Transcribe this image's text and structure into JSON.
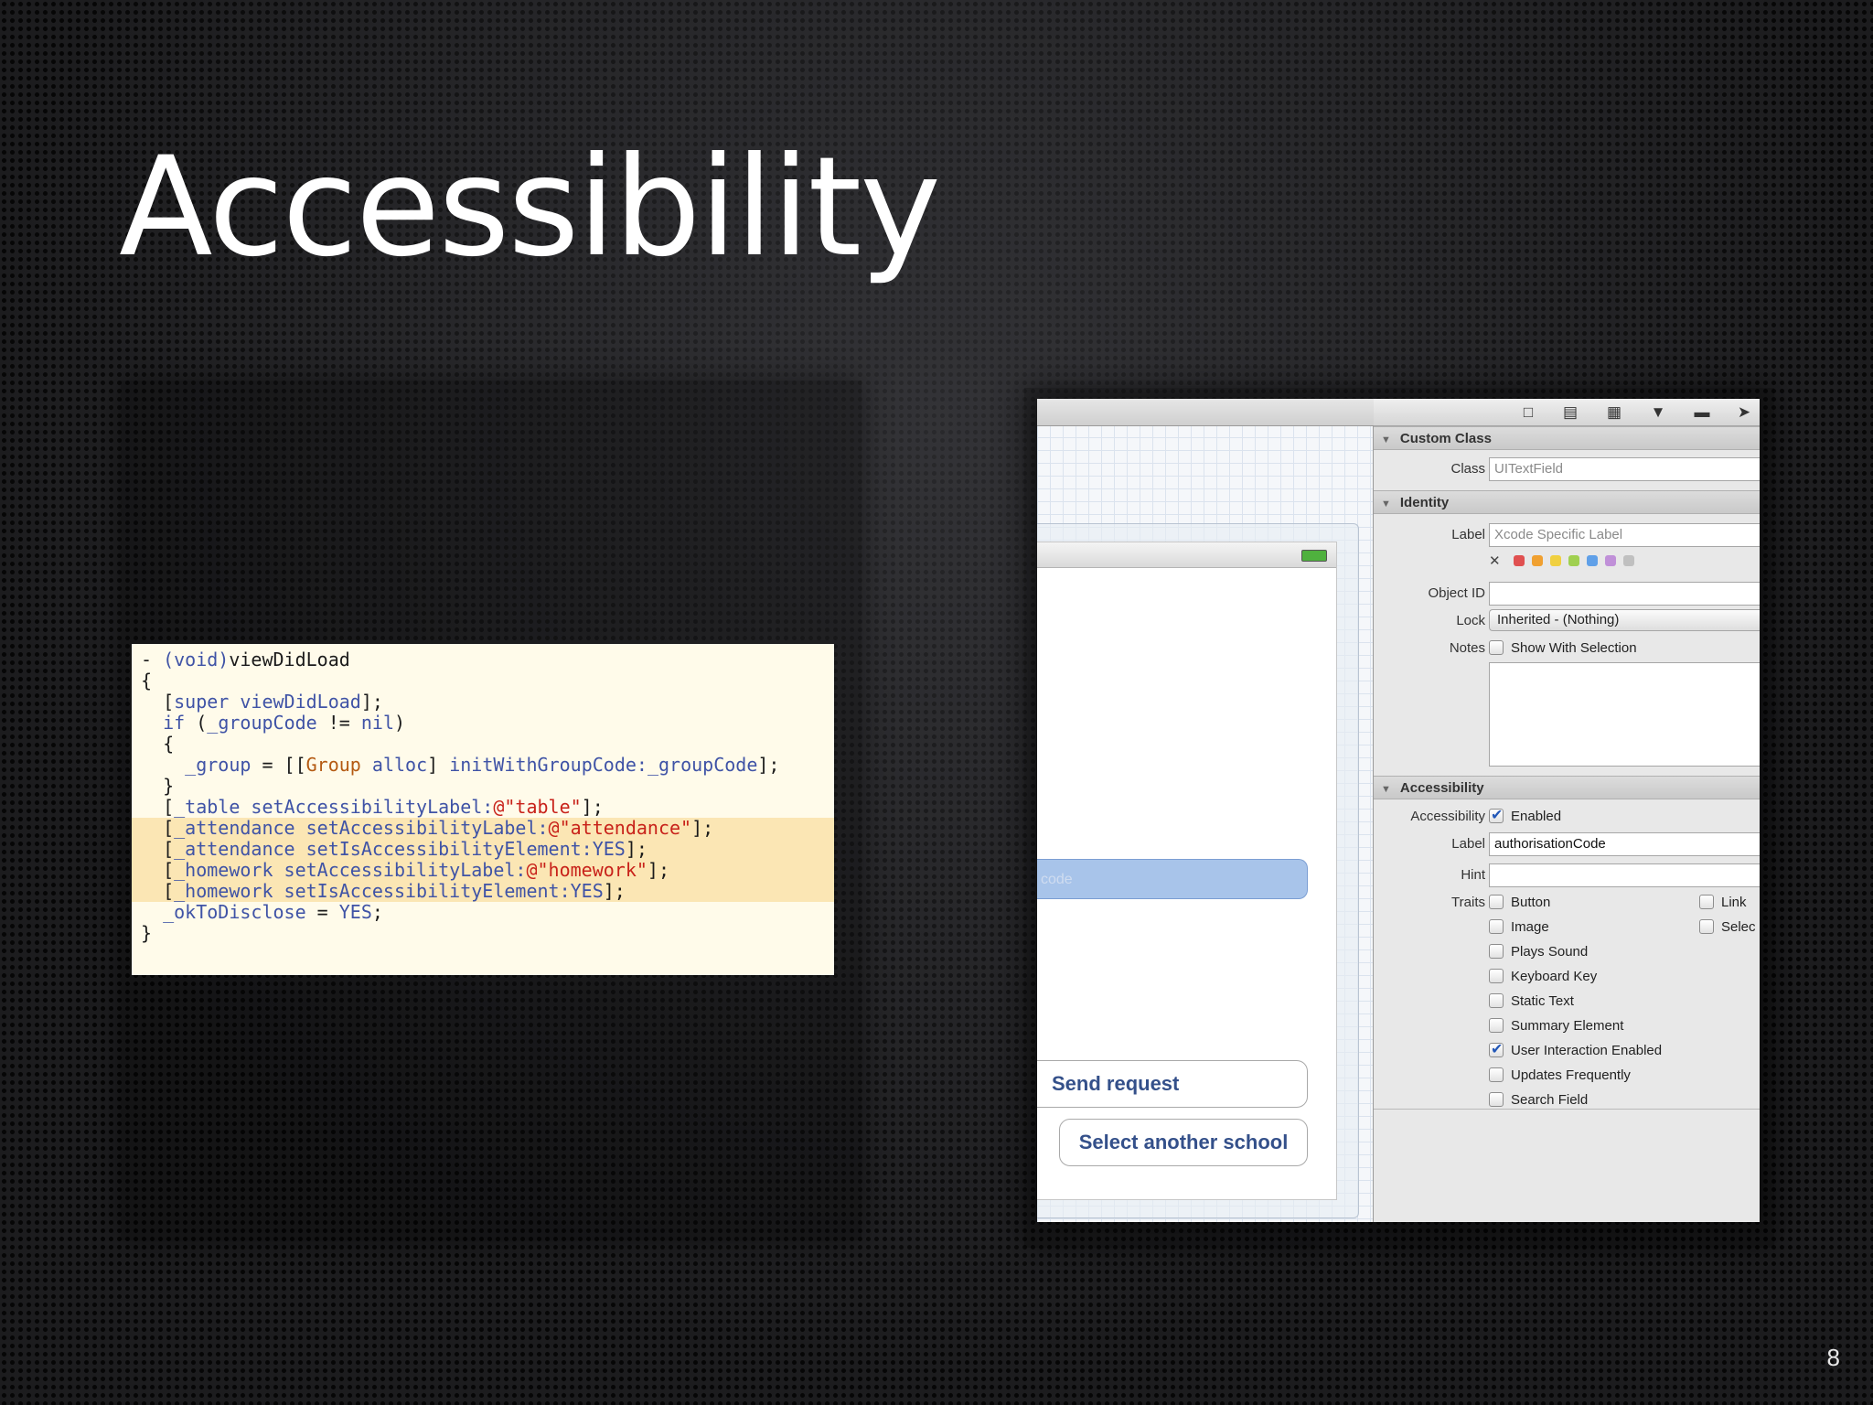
{
  "slide": {
    "title": "Accessibility",
    "page_number": "8"
  },
  "code": {
    "lines": [
      {
        "segments": [
          {
            "t": "- ",
            "c": ""
          },
          {
            "t": "(void)",
            "c": "kw"
          },
          {
            "t": "viewDidLoad",
            "c": ""
          }
        ],
        "highlight": false
      },
      {
        "segments": [
          {
            "t": "{",
            "c": ""
          }
        ],
        "highlight": false
      },
      {
        "segments": [
          {
            "t": "  [",
            "c": ""
          },
          {
            "t": "super",
            "c": "kw"
          },
          {
            "t": " ",
            "c": ""
          },
          {
            "t": "viewDidLoad",
            "c": "kw"
          },
          {
            "t": "];",
            "c": ""
          }
        ],
        "highlight": false
      },
      {
        "segments": [
          {
            "t": "  ",
            "c": ""
          },
          {
            "t": "if",
            "c": "kw"
          },
          {
            "t": " (",
            "c": ""
          },
          {
            "t": "_groupCode",
            "c": "kw"
          },
          {
            "t": " != ",
            "c": ""
          },
          {
            "t": "nil",
            "c": "kw"
          },
          {
            "t": ")",
            "c": ""
          }
        ],
        "highlight": false
      },
      {
        "segments": [
          {
            "t": "  {",
            "c": ""
          }
        ],
        "highlight": false
      },
      {
        "segments": [
          {
            "t": "    ",
            "c": ""
          },
          {
            "t": "_group",
            "c": "kw"
          },
          {
            "t": " = [[",
            "c": ""
          },
          {
            "t": "Group",
            "c": "cls"
          },
          {
            "t": " ",
            "c": ""
          },
          {
            "t": "alloc",
            "c": "kw"
          },
          {
            "t": "] ",
            "c": ""
          },
          {
            "t": "initWithGroupCode:",
            "c": "kw"
          },
          {
            "t": "_groupCode",
            "c": "kw"
          },
          {
            "t": "];",
            "c": ""
          }
        ],
        "highlight": false
      },
      {
        "segments": [
          {
            "t": "  }",
            "c": ""
          }
        ],
        "highlight": false
      },
      {
        "segments": [
          {
            "t": "  [",
            "c": ""
          },
          {
            "t": "_table",
            "c": "kw"
          },
          {
            "t": " ",
            "c": ""
          },
          {
            "t": "setAccessibilityLabel:",
            "c": "kw"
          },
          {
            "t": "@\"table\"",
            "c": "str"
          },
          {
            "t": "];",
            "c": ""
          }
        ],
        "highlight": false
      },
      {
        "segments": [
          {
            "t": "  [",
            "c": ""
          },
          {
            "t": "_attendance",
            "c": "kw"
          },
          {
            "t": " ",
            "c": ""
          },
          {
            "t": "setAccessibilityLabel:",
            "c": "kw"
          },
          {
            "t": "@\"attendance\"",
            "c": "str"
          },
          {
            "t": "];",
            "c": ""
          }
        ],
        "highlight": true
      },
      {
        "segments": [
          {
            "t": "  [",
            "c": ""
          },
          {
            "t": "_attendance",
            "c": "kw"
          },
          {
            "t": " ",
            "c": ""
          },
          {
            "t": "setIsAccessibilityElement:",
            "c": "kw"
          },
          {
            "t": "YES",
            "c": "kw"
          },
          {
            "t": "];",
            "c": ""
          }
        ],
        "highlight": true
      },
      {
        "segments": [
          {
            "t": "  [",
            "c": ""
          },
          {
            "t": "_homework",
            "c": "kw"
          },
          {
            "t": " ",
            "c": ""
          },
          {
            "t": "setAccessibilityLabel:",
            "c": "kw"
          },
          {
            "t": "@\"homework\"",
            "c": "str"
          },
          {
            "t": "];",
            "c": ""
          }
        ],
        "highlight": true
      },
      {
        "segments": [
          {
            "t": "  [",
            "c": ""
          },
          {
            "t": "_homework",
            "c": "kw"
          },
          {
            "t": " ",
            "c": ""
          },
          {
            "t": "setIsAccessibilityElement:",
            "c": "kw"
          },
          {
            "t": "YES",
            "c": "kw"
          },
          {
            "t": "];",
            "c": ""
          }
        ],
        "highlight": true
      },
      {
        "segments": [
          {
            "t": "  ",
            "c": ""
          },
          {
            "t": "_okToDisclose",
            "c": "kw"
          },
          {
            "t": " = ",
            "c": ""
          },
          {
            "t": "YES",
            "c": "kw"
          },
          {
            "t": ";",
            "c": ""
          }
        ],
        "highlight": false
      },
      {
        "segments": [
          {
            "t": "}",
            "c": ""
          }
        ],
        "highlight": false
      }
    ]
  },
  "canvas": {
    "text_field_placeholder": "code",
    "send_button": "Send request",
    "select_button": "Select another school"
  },
  "inspector": {
    "toolbar_icons": [
      "file-icon",
      "quick-help-icon",
      "identity-icon",
      "attributes-icon",
      "size-icon",
      "connections-icon"
    ],
    "custom_class": {
      "header": "Custom Class",
      "class_label": "Class",
      "class_value": "UITextField"
    },
    "identity": {
      "header": "Identity",
      "label_label": "Label",
      "label_placeholder": "Xcode Specific Label",
      "colors": [
        "#e05050",
        "#f0a030",
        "#f0d040",
        "#a0d050",
        "#60a0e8",
        "#c090d8",
        "#c0c0c0"
      ],
      "object_id_label": "Object ID",
      "object_id_value": "",
      "lock_label": "Lock",
      "lock_value": "Inherited - (Nothing)",
      "notes_label": "Notes",
      "notes_checkbox": "Show With Selection"
    },
    "accessibility": {
      "header": "Accessibility",
      "accessibility_label": "Accessibility",
      "enabled_label": "Enabled",
      "enabled_checked": true,
      "label_label": "Label",
      "label_value": "authorisationCode",
      "hint_label": "Hint",
      "hint_value": "",
      "traits_label": "Traits",
      "traits": [
        {
          "label": "Button",
          "checked": false
        },
        {
          "label": "Image",
          "checked": false
        },
        {
          "label": "Plays Sound",
          "checked": false
        },
        {
          "label": "Keyboard Key",
          "checked": false
        },
        {
          "label": "Static Text",
          "checked": false
        },
        {
          "label": "Summary Element",
          "checked": false
        },
        {
          "label": "User Interaction Enabled",
          "checked": true
        },
        {
          "label": "Updates Frequently",
          "checked": false
        },
        {
          "label": "Search Field",
          "checked": false
        }
      ],
      "traits_right": [
        {
          "label": "Link",
          "checked": false
        },
        {
          "label": "Selec",
          "checked": false
        }
      ]
    }
  }
}
